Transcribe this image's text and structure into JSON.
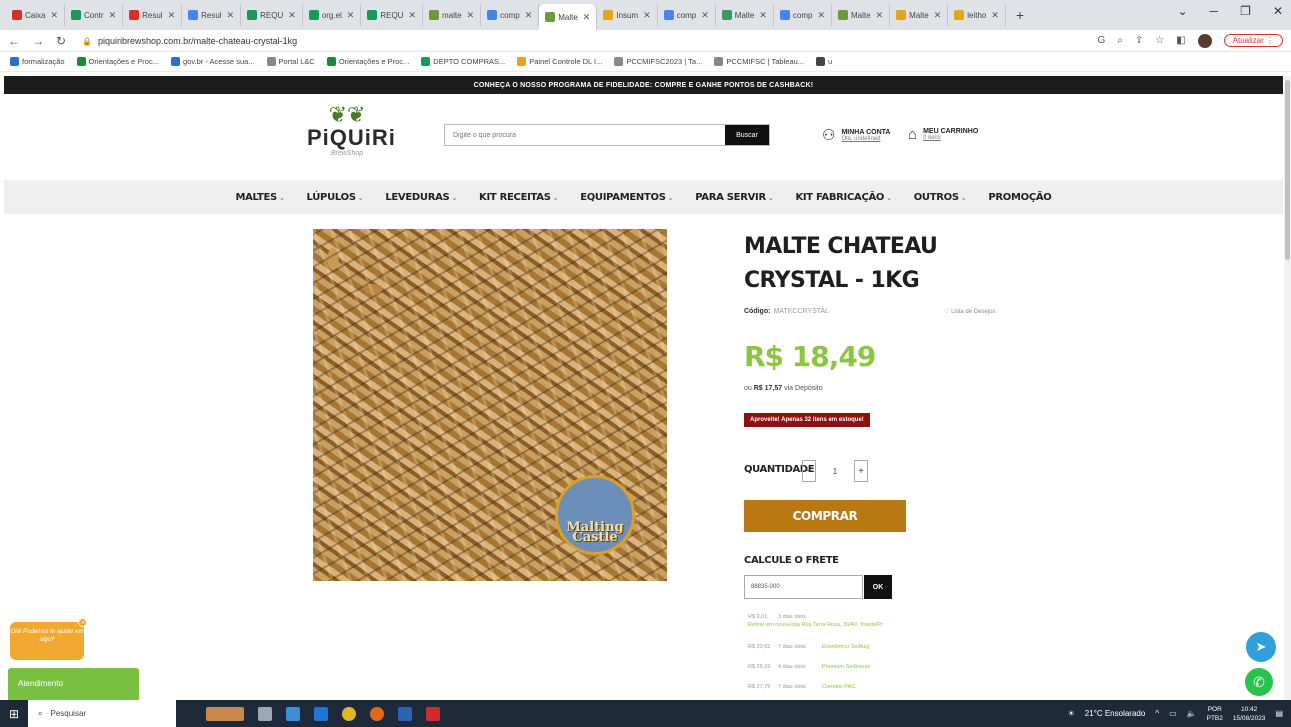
{
  "browser": {
    "tabs": [
      {
        "label": "Caixa",
        "color": "#d93025"
      },
      {
        "label": "Contr",
        "color": "#0f9d58"
      },
      {
        "label": "Resul",
        "color": "#d93025"
      },
      {
        "label": "Resul",
        "color": "#4285f4"
      },
      {
        "label": "REQU",
        "color": "#0f9d58"
      },
      {
        "label": "org.el",
        "color": "#0f9d58"
      },
      {
        "label": "REQU",
        "color": "#0f9d58"
      },
      {
        "label": "malte",
        "color": "#6a9b3a"
      },
      {
        "label": "comp",
        "color": "#4285f4"
      },
      {
        "label": "Malte",
        "color": "#6a9b3a",
        "active": true
      },
      {
        "label": "Insum",
        "color": "#e8a317"
      },
      {
        "label": "comp",
        "color": "#4285f4"
      },
      {
        "label": "Malte",
        "color": "#3c9a5f"
      },
      {
        "label": "comp",
        "color": "#4285f4"
      },
      {
        "label": "Malte",
        "color": "#6a9b3a"
      },
      {
        "label": "Malte",
        "color": "#e8a317"
      },
      {
        "label": "leitho",
        "color": "#e8a317"
      }
    ],
    "url": "piquiribrewshop.com.br/malte-chateau-crystal-1kg",
    "update_label": "Atualizar",
    "bookmarks": [
      {
        "label": "formalização",
        "color": "#2a6fd6"
      },
      {
        "label": "Orientações e Proc...",
        "color": "#1b8a3a"
      },
      {
        "label": "gov.br - Acesse sua...",
        "color": "#2a6fd6"
      },
      {
        "label": "Portal L&C",
        "color": "#888888"
      },
      {
        "label": "Orientações e Proc...",
        "color": "#1b8a3a"
      },
      {
        "label": "DEPTO COMPRAS...",
        "color": "#0f9d58"
      },
      {
        "label": "Painel Controle DL I...",
        "color": "#e8a317"
      },
      {
        "label": "PCCMIFSC2023 | Ta...",
        "color": "#888888"
      },
      {
        "label": "PCCMIFSC | Tableau...",
        "color": "#888888"
      },
      {
        "label": "u",
        "color": "#444444"
      }
    ]
  },
  "site": {
    "promo": "CONHEÇA O NOSSO PROGRAMA DE FIDELIDADE: COMPRE E GANHE PONTOS DE CASHBACK!",
    "logo_name": "PiQUiRi",
    "logo_sub": "BrewShop",
    "search_placeholder": "Digite o que procura",
    "search_button": "Buscar",
    "account_title": "MINHA CONTA",
    "account_sub": "Olá, undefined",
    "cart_title": "MEU CARRINHO",
    "cart_sub": "0 itens",
    "menu": [
      {
        "label": "MALTES",
        "chev": true
      },
      {
        "label": "LÚPULOS",
        "chev": true
      },
      {
        "label": "LEVEDURAS",
        "chev": true
      },
      {
        "label": "KIT RECEITAS",
        "chev": true
      },
      {
        "label": "EQUIPAMENTOS",
        "chev": true
      },
      {
        "label": "PARA SERVIR",
        "chev": true
      },
      {
        "label": "KIT FABRICAÇÃO",
        "chev": true
      },
      {
        "label": "OUTROS",
        "chev": true
      },
      {
        "label": "PROMOÇÃO",
        "chev": false
      }
    ]
  },
  "product": {
    "title": "MALTE CHATEAU CRYSTAL - 1KG",
    "code_label": "Código:",
    "code_value": "MATKCCRYSTAL",
    "wishlist": "Lista de Desejos",
    "price": "R$ 18,49",
    "deposit_prefix": "ou",
    "deposit_price": "R$ 17,57",
    "deposit_suffix": "via Depósito",
    "stock_badge": "Aproveite! Apenas 32 itens em estoque!",
    "badge_line1": "Castle",
    "badge_line2": "Malting",
    "qty_label": "QUANTIDADE",
    "qty_value": "1",
    "buy_label": "COMPRAR",
    "freight_title": "CALCULE O FRETE",
    "cep_value": "88835-000",
    "ok_label": "OK",
    "shipping": [
      {
        "price": "R$ 0,01",
        "days": "3 dias úteis",
        "name": "",
        "sub": "Retirar em nossa loja Rua Terra Rosa, 30/40, Toledo/Pr"
      },
      {
        "price": "R$ 20,92",
        "days": "7 dias úteis",
        "name": "Econômico Sedtuig",
        "sub": ""
      },
      {
        "price": "R$ 26,19",
        "days": "4 dias úteis",
        "name": "Premium Sedtravas",
        "sub": ""
      },
      {
        "price": "R$ 27,79",
        "days": "7 dias úteis",
        "name": "Correios PAC",
        "sub": ""
      }
    ]
  },
  "widgets": {
    "chat_bubble": "Olá! Podemos te ajudar em algo?",
    "attendance": "Atendimento"
  },
  "taskbar": {
    "search": "Pesquisar",
    "weather": "21°C Ensolarado",
    "lang1": "POR",
    "lang2": "PTB2",
    "time": "10:42",
    "date": "15/08/2023"
  }
}
